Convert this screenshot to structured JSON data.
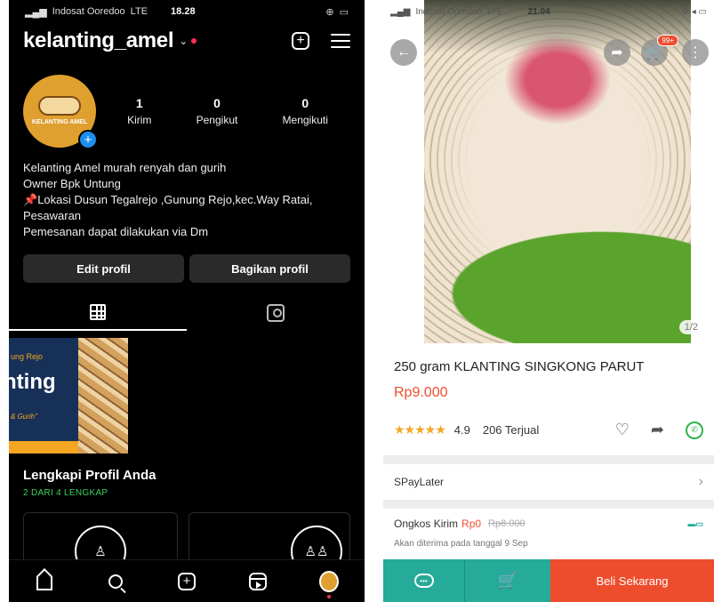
{
  "instagram": {
    "status": {
      "carrier": "Indosat Ooredoo",
      "network": "LTE",
      "time": "18.28"
    },
    "header": {
      "username": "kelanting_amel"
    },
    "avatar": {
      "logo_text": "KELANTING AMEL"
    },
    "stats": [
      {
        "value": "1",
        "label": "Kirim"
      },
      {
        "value": "0",
        "label": "Pengikut"
      },
      {
        "value": "0",
        "label": "Mengikuti"
      }
    ],
    "bio": {
      "line1": "Kelanting Amel murah renyah dan gurih",
      "line2": "Owner Bpk Untung",
      "line3": "Lokasi Dusun Tegalrejo ,Gunung Rejo,kec.Way Ratai, Pesawaran",
      "line4": "Pemesanan dapat dilakukan via Dm"
    },
    "buttons": {
      "edit": "Edit profil",
      "share": "Bagikan profil"
    },
    "post": {
      "text1": "ung Rejo",
      "text2": "nting",
      "text3": "& Gurih\""
    },
    "complete": {
      "title": "Lengkapi Profil Anda",
      "subtitle": "2 DARI 4 LENGKAP"
    }
  },
  "shopee": {
    "status": {
      "carrier": "Indosat Ooredoo",
      "network": "LTE",
      "time": "21.04"
    },
    "cart_badge": "99+",
    "image_counter": "1/2",
    "product": {
      "title": "250 gram KLANTING SINGKONG PARUT",
      "price": "Rp9.000",
      "rating": "4.9",
      "rating_stars": 4.9,
      "sold": "206 Terjual"
    },
    "paylater": "SPayLater",
    "shipping": {
      "label": "Ongkos Kirim",
      "free": "Rp0",
      "old": "Rp8.000",
      "note": "Akan diterima pada tanggal 9 Sep"
    },
    "buy_button": "Beli Sekarang"
  }
}
